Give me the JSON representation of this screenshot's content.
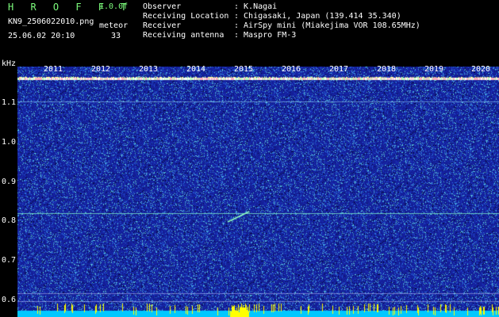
{
  "header": {
    "app_title": "H R O F F T",
    "version": "1.0.0f",
    "filename": "KN9_2506022010.png",
    "meteor_label": "meteor",
    "timestamp": "25.06.02 20:10",
    "meteor_count": "33"
  },
  "metadata": [
    {
      "key": "Observer",
      "value": ": K.Nagai"
    },
    {
      "key": "Receiving Location",
      "value": ": Chigasaki, Japan (139.414 35.340)"
    },
    {
      "key": "Receiver",
      "value": ": AirSpy mini (Miakejima VOR 108.65MHz)"
    },
    {
      "key": "Receiving antenna",
      "value": ": Maspro FM-3"
    }
  ],
  "axis": {
    "unit": "kHz",
    "y_ticks": [
      "1.1",
      "1.0",
      "0.9",
      "0.8",
      "0.7",
      "0.6"
    ],
    "years": [
      "2011",
      "2012",
      "2013",
      "2014",
      "2015",
      "2016",
      "2017",
      "2018",
      "2019",
      "2020"
    ]
  },
  "colors": {
    "background": "#000000",
    "title_green": "#7CFC7C",
    "spectrum_base": "#1a2a9a",
    "signal_line": "#ffb0b0",
    "meteor_trail": "#8fffc0",
    "bottom_bar": "#00c8ff",
    "bottom_peak": "#ffff00"
  }
}
